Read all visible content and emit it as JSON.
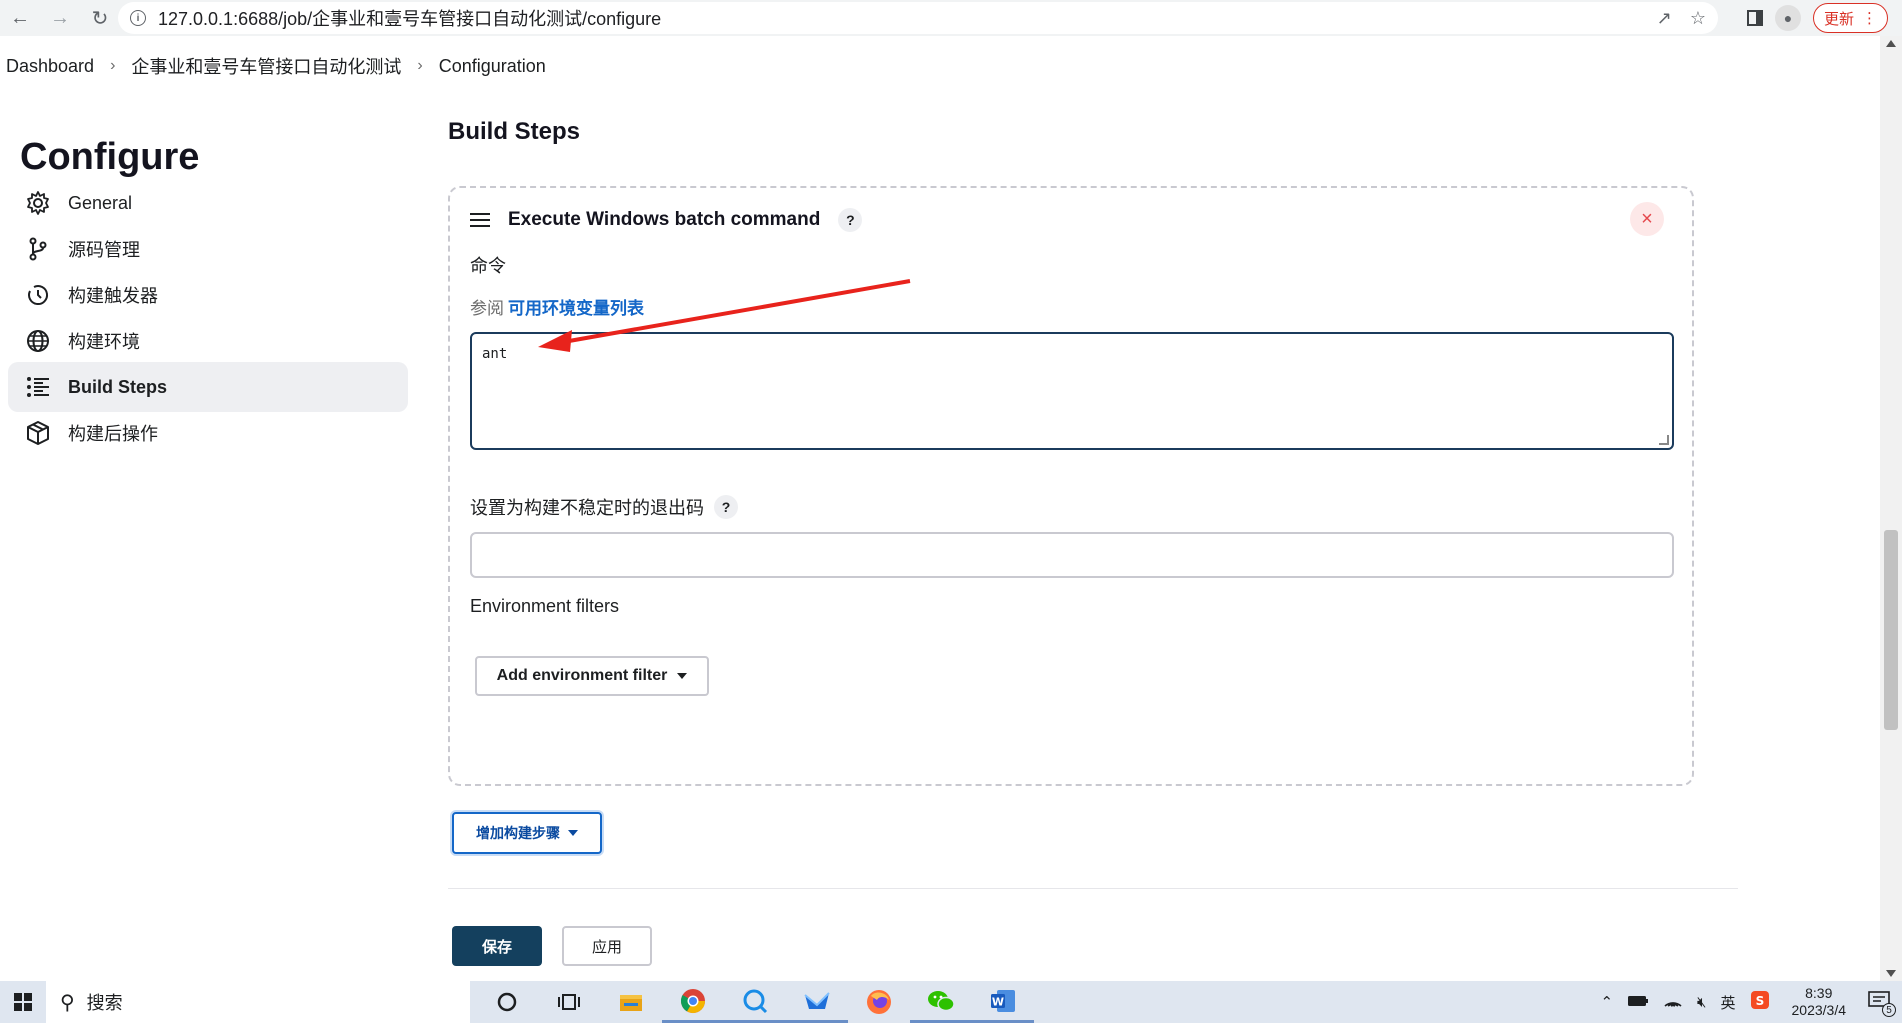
{
  "browser": {
    "url": "127.0.0.1:6688/job/企事业和壹号车管接口自动化测试/configure",
    "update_label": "更新"
  },
  "breadcrumb": {
    "items": [
      "Dashboard",
      "企事业和壹号车管接口自动化测试",
      "Configuration"
    ]
  },
  "sidebar": {
    "title": "Configure",
    "items": [
      {
        "label": "General",
        "icon": "gear-icon"
      },
      {
        "label": "源码管理",
        "icon": "branch-icon"
      },
      {
        "label": "构建触发器",
        "icon": "clock-icon"
      },
      {
        "label": "构建环境",
        "icon": "globe-icon"
      },
      {
        "label": "Build Steps",
        "icon": "list-icon",
        "active": true
      },
      {
        "label": "构建后操作",
        "icon": "cube-icon"
      }
    ]
  },
  "main": {
    "section_title": "Build Steps",
    "step": {
      "title": "Execute Windows batch command",
      "help": "?",
      "close": "×",
      "command_label": "命令",
      "see_also_prefix": "参阅",
      "see_also_link": "可用环境变量列表",
      "command_value": "ant",
      "unstable_label": "设置为构建不稳定时的退出码",
      "unstable_value": "",
      "env_filters_label": "Environment filters",
      "env_filter_button": "Add environment filter"
    },
    "add_step_button": "增加构建步骤",
    "save_button": "保存",
    "apply_button": "应用"
  },
  "taskbar": {
    "search_label": "搜索",
    "time": "8:39",
    "date": "2023/3/4",
    "ime": "英",
    "notifications": "5"
  },
  "colors": {
    "accent": "#1467c8",
    "save_bg": "#14405e",
    "annotation": "#e8231c",
    "close": "#e5484d"
  }
}
